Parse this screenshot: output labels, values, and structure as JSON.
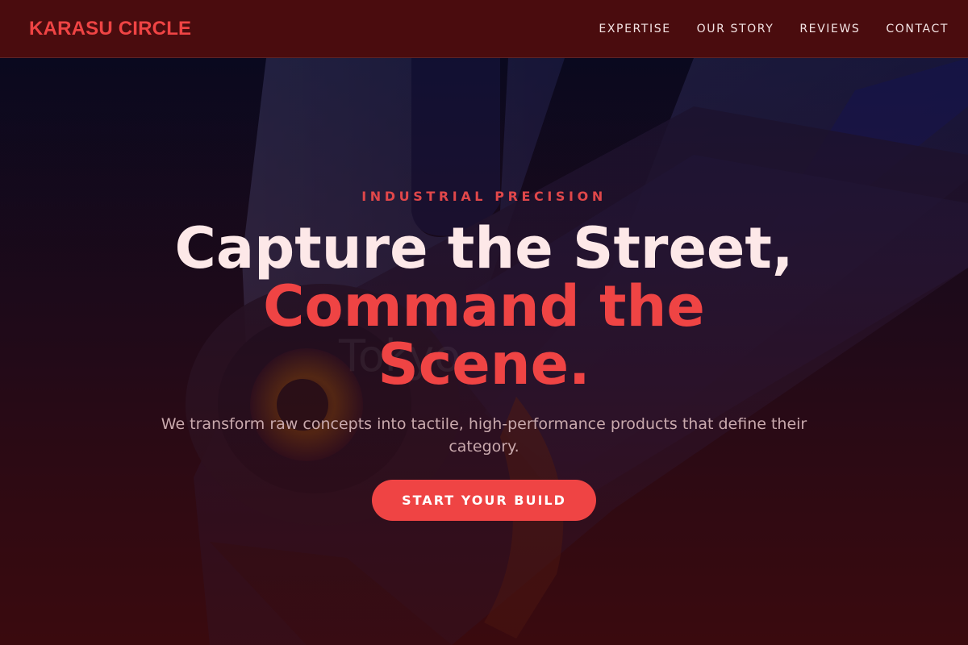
{
  "header": {
    "brand": "KARASU CIRCLE",
    "nav": [
      "EXPERTISE",
      "OUR STORY",
      "REVIEWS",
      "CONTACT"
    ]
  },
  "hero": {
    "eyebrow": "INDUSTRIAL PRECISION",
    "headline_line1": "Capture the Street,",
    "headline_line2": "Command the Scene.",
    "subtext": "We transform raw concepts into tactile, high-performance products that define their category.",
    "cta_label": "START YOUR BUILD",
    "watermark": "Tokyo"
  },
  "colors": {
    "accent": "#ef4444",
    "header_bg": "#4a0c0e",
    "page_bg": "#3a0a0e",
    "headline_light": "#fde8e8"
  }
}
